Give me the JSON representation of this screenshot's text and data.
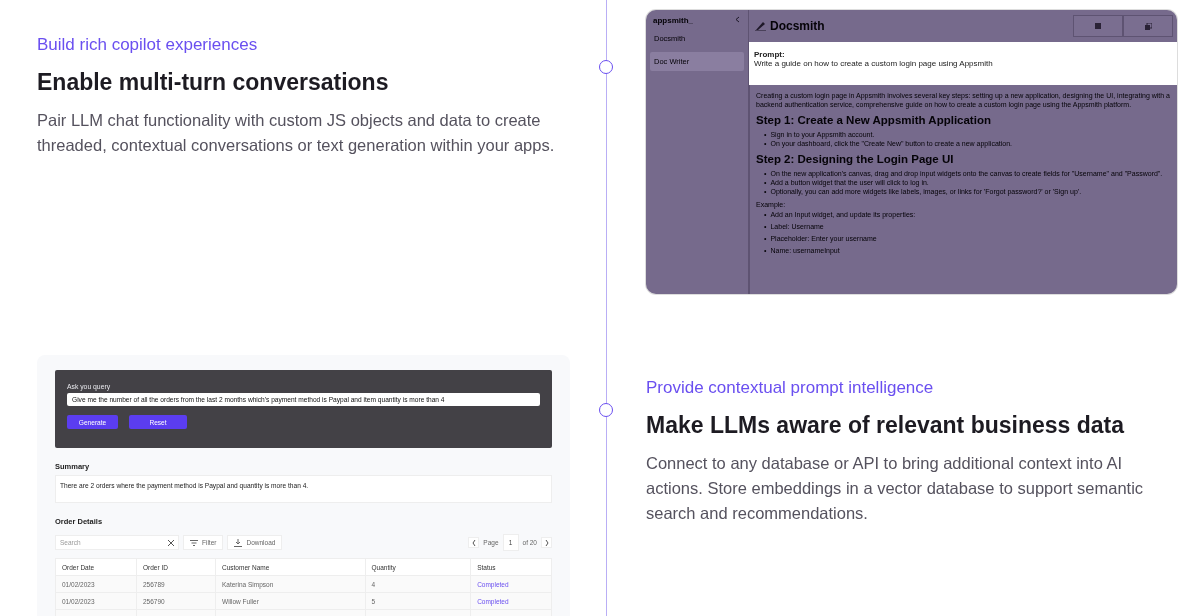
{
  "features": [
    {
      "eyebrow": "Build rich copilot experiences",
      "heading": "Enable multi-turn conversations",
      "body": "Pair LLM chat functionality with custom JS objects and data to create threaded, contextual conversations or text generation within your apps."
    },
    {
      "eyebrow": "Provide contextual prompt intelligence",
      "heading": "Make LLMs aware of relevant business data",
      "body": "Connect to any database or API to bring additional context into AI actions. Store embeddings in a vector database to support semantic search and recommendations."
    }
  ],
  "docsmith": {
    "brand": "appsmith_",
    "sidebar_items": [
      {
        "label": "Docsmith",
        "selected": false
      },
      {
        "label": "Doc Writer",
        "selected": true
      }
    ],
    "title": "Docsmith",
    "prompt_label": "Prompt:",
    "prompt": "Write a guide on how to create a custom login page using Appsmith",
    "intro": "Creating a custom login page in Appsmith involves several key steps: setting up a new application, designing the UI, integrating with a backend authentication service, comprehensive guide on how to create a custom login page using the Appsmith platform.",
    "sections": [
      {
        "heading": "Step 1: Create a New Appsmith Application",
        "bullets": [
          "Sign in to your Appsmith account.",
          "On your dashboard, click the \"Create New\" button to create a new application."
        ]
      },
      {
        "heading": "Step 2: Designing the Login Page UI",
        "bullets": [
          "On the new application's canvas, drag and drop input widgets onto the canvas to create fields for \"Username\" and \"Password\".",
          "Add a button widget that the user will click to log in.",
          "Optionally, you can add more widgets like labels, images, or links for 'Forgot password?' or 'Sign up'."
        ]
      }
    ],
    "bullet": "•",
    "example_label": "Example:",
    "example_bullets": [
      "Add an Input widget, and update its properties:",
      "Label: Username",
      "Placeholder: Enter your username",
      "Name: usernameInput"
    ]
  },
  "query_app": {
    "query_label": "Ask you query",
    "query": "Give me the number of all the orders from the last 2 months which's payment method is Paypal and item quantity is more than 4",
    "buttons": [
      "Generate",
      "Reset"
    ],
    "summary_label": "Summary",
    "summary": "There are 2 orders where the payment method is Paypal and quantity is more than 4.",
    "table_title": "Order Details",
    "search_placeholder": "Search",
    "filter": "Filter",
    "download": "Download",
    "page_label": "Page",
    "page": "1",
    "page_total": "of 20",
    "columns": [
      "Order Date",
      "Order ID",
      "Customer Name",
      "Quantity",
      "Status"
    ],
    "rows": [
      [
        "01/02/2023",
        "256789",
        "Katerina Simpson",
        "4",
        "Completed"
      ],
      [
        "01/02/2023",
        "256790",
        "Willow Fuller",
        "5",
        "Completed"
      ]
    ]
  }
}
